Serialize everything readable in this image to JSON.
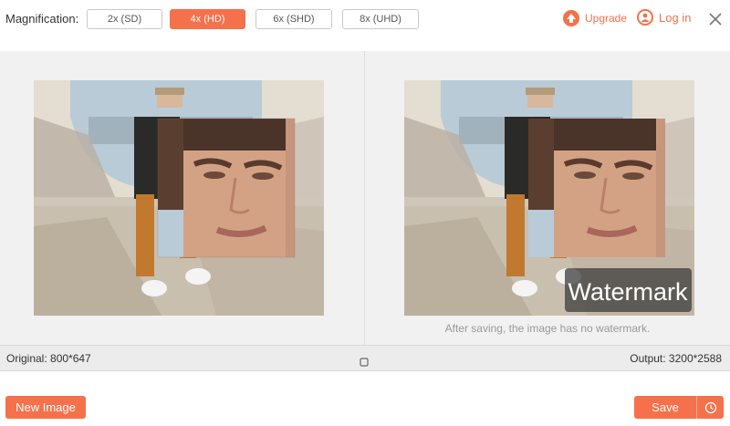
{
  "topbar": {
    "magnification_label": "Magnification:",
    "options": [
      {
        "label": "2x (SD)"
      },
      {
        "label": "4x (HD)"
      },
      {
        "label": "6x (SHD)"
      },
      {
        "label": "8x (UHD)"
      }
    ],
    "selected": "4x (HD)",
    "upgrade_label": "Upgrade",
    "login_label": "Log in"
  },
  "preview": {
    "watermark_text": "Watermark",
    "watermark_note": "After saving, the image has no watermark."
  },
  "info": {
    "original": "Original: 800*647",
    "output": "Output: 3200*2588"
  },
  "actions": {
    "new_image": "New Image",
    "save": "Save"
  },
  "colors": {
    "accent": "#f5714c",
    "panel_bg": "#f1f1f1"
  },
  "icons": [
    "upgrade-arrow-icon",
    "user-icon",
    "close-icon",
    "compare-icon",
    "history-clock-icon"
  ]
}
